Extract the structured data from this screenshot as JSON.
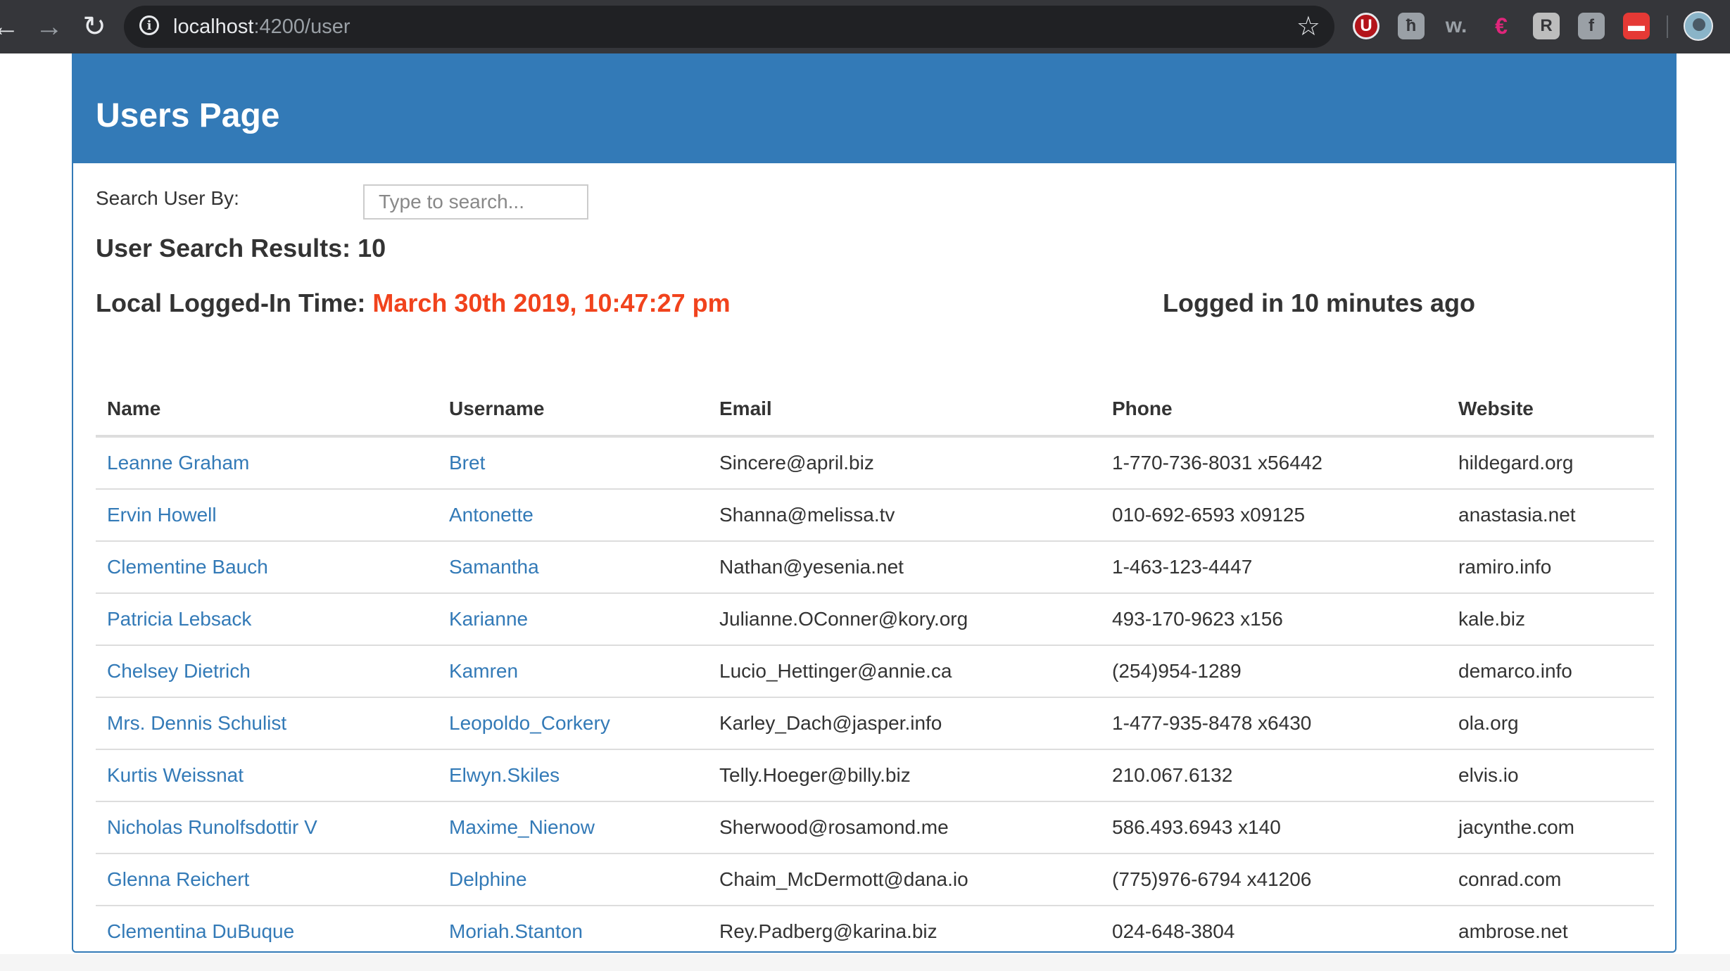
{
  "browser": {
    "url_host": "localhost",
    "url_path": ":4200/user",
    "back_icon": "arrow-left-icon",
    "forward_icon": "arrow-right-icon",
    "reload_icon": "reload-icon",
    "star_icon": "star-icon",
    "extensions": [
      {
        "name": "ublock-icon",
        "glyph": "U"
      },
      {
        "name": "extension-h-icon",
        "glyph": "ħ"
      },
      {
        "name": "extension-w-icon",
        "glyph": "w."
      },
      {
        "name": "extension-e-icon",
        "glyph": "€"
      },
      {
        "name": "extension-r-icon",
        "glyph": "R"
      },
      {
        "name": "extension-f-icon",
        "glyph": "f"
      },
      {
        "name": "extension-toolbox-icon",
        "glyph": "▬"
      }
    ]
  },
  "page": {
    "title": "Users Page",
    "search_label": "Search User By:",
    "search_placeholder": "Type to search...",
    "results_label": "User Search Results: 10",
    "logged_label": "Local Logged-In Time: ",
    "logged_timestamp": "March 30th 2019, 10:47:27 pm",
    "logged_ago": "Logged in 10 minutes ago"
  },
  "table": {
    "headers": [
      "Name",
      "Username",
      "Email",
      "Phone",
      "Website"
    ],
    "rows": [
      {
        "name": "Leanne Graham",
        "username": "Bret",
        "email": "Sincere@april.biz",
        "phone": "1-770-736-8031 x56442",
        "website": "hildegard.org"
      },
      {
        "name": "Ervin Howell",
        "username": "Antonette",
        "email": "Shanna@melissa.tv",
        "phone": "010-692-6593 x09125",
        "website": "anastasia.net"
      },
      {
        "name": "Clementine Bauch",
        "username": "Samantha",
        "email": "Nathan@yesenia.net",
        "phone": "1-463-123-4447",
        "website": "ramiro.info"
      },
      {
        "name": "Patricia Lebsack",
        "username": "Karianne",
        "email": "Julianne.OConner@kory.org",
        "phone": "493-170-9623 x156",
        "website": "kale.biz"
      },
      {
        "name": "Chelsey Dietrich",
        "username": "Kamren",
        "email": "Lucio_Hettinger@annie.ca",
        "phone": "(254)954-1289",
        "website": "demarco.info"
      },
      {
        "name": "Mrs. Dennis Schulist",
        "username": "Leopoldo_Corkery",
        "email": "Karley_Dach@jasper.info",
        "phone": "1-477-935-8478 x6430",
        "website": "ola.org"
      },
      {
        "name": "Kurtis Weissnat",
        "username": "Elwyn.Skiles",
        "email": "Telly.Hoeger@billy.biz",
        "phone": "210.067.6132",
        "website": "elvis.io"
      },
      {
        "name": "Nicholas Runolfsdottir V",
        "username": "Maxime_Nienow",
        "email": "Sherwood@rosamond.me",
        "phone": "586.493.6943 x140",
        "website": "jacynthe.com"
      },
      {
        "name": "Glenna Reichert",
        "username": "Delphine",
        "email": "Chaim_McDermott@dana.io",
        "phone": "(775)976-6794 x41206",
        "website": "conrad.com"
      },
      {
        "name": "Clementina DuBuque",
        "username": "Moriah.Stanton",
        "email": "Rey.Padberg@karina.biz",
        "phone": "024-648-3804",
        "website": "ambrose.net"
      }
    ]
  },
  "colors": {
    "primary": "#337ab7",
    "timestamp": "#f1431d",
    "chrome": "#35363a"
  }
}
